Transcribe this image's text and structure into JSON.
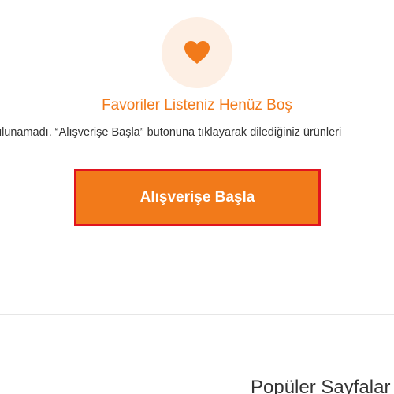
{
  "empty_state": {
    "icon": "heart-icon",
    "title": "Favoriler Listeniz Henüz Boş",
    "description": "ulunamadı. “Alışverişe Başla” butonuna tıklayarak dilediğiniz ürünleri",
    "cta_label": "Alışverişe Başla"
  },
  "popular": {
    "heading": "Popüler Sayfalar"
  },
  "colors": {
    "accent": "#f27a1a",
    "icon_background": "#fdefe4",
    "highlight_outline": "#e0141f"
  }
}
